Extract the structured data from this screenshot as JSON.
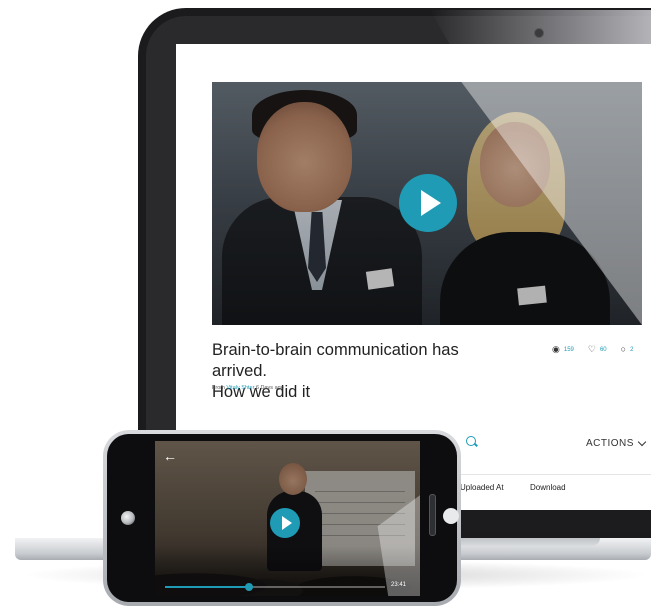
{
  "video_post": {
    "title_line1": "Brain-to-brain communication has arrived.",
    "title_line2": "How we did it",
    "meta_from": "From",
    "meta_author": "Vitaly Shter",
    "meta_age": "6 Days ago",
    "views": "159",
    "likes": "60",
    "comments": "2"
  },
  "toolbar": {
    "actions_label": "ACTIONS"
  },
  "table": {
    "columns": [
      "Uploaded At",
      "Download"
    ]
  },
  "phone_player": {
    "back_glyph": "←",
    "time": "23:41",
    "progress": 0.38
  },
  "colors": {
    "accent": "#1f9bb5",
    "text": "#222222"
  }
}
